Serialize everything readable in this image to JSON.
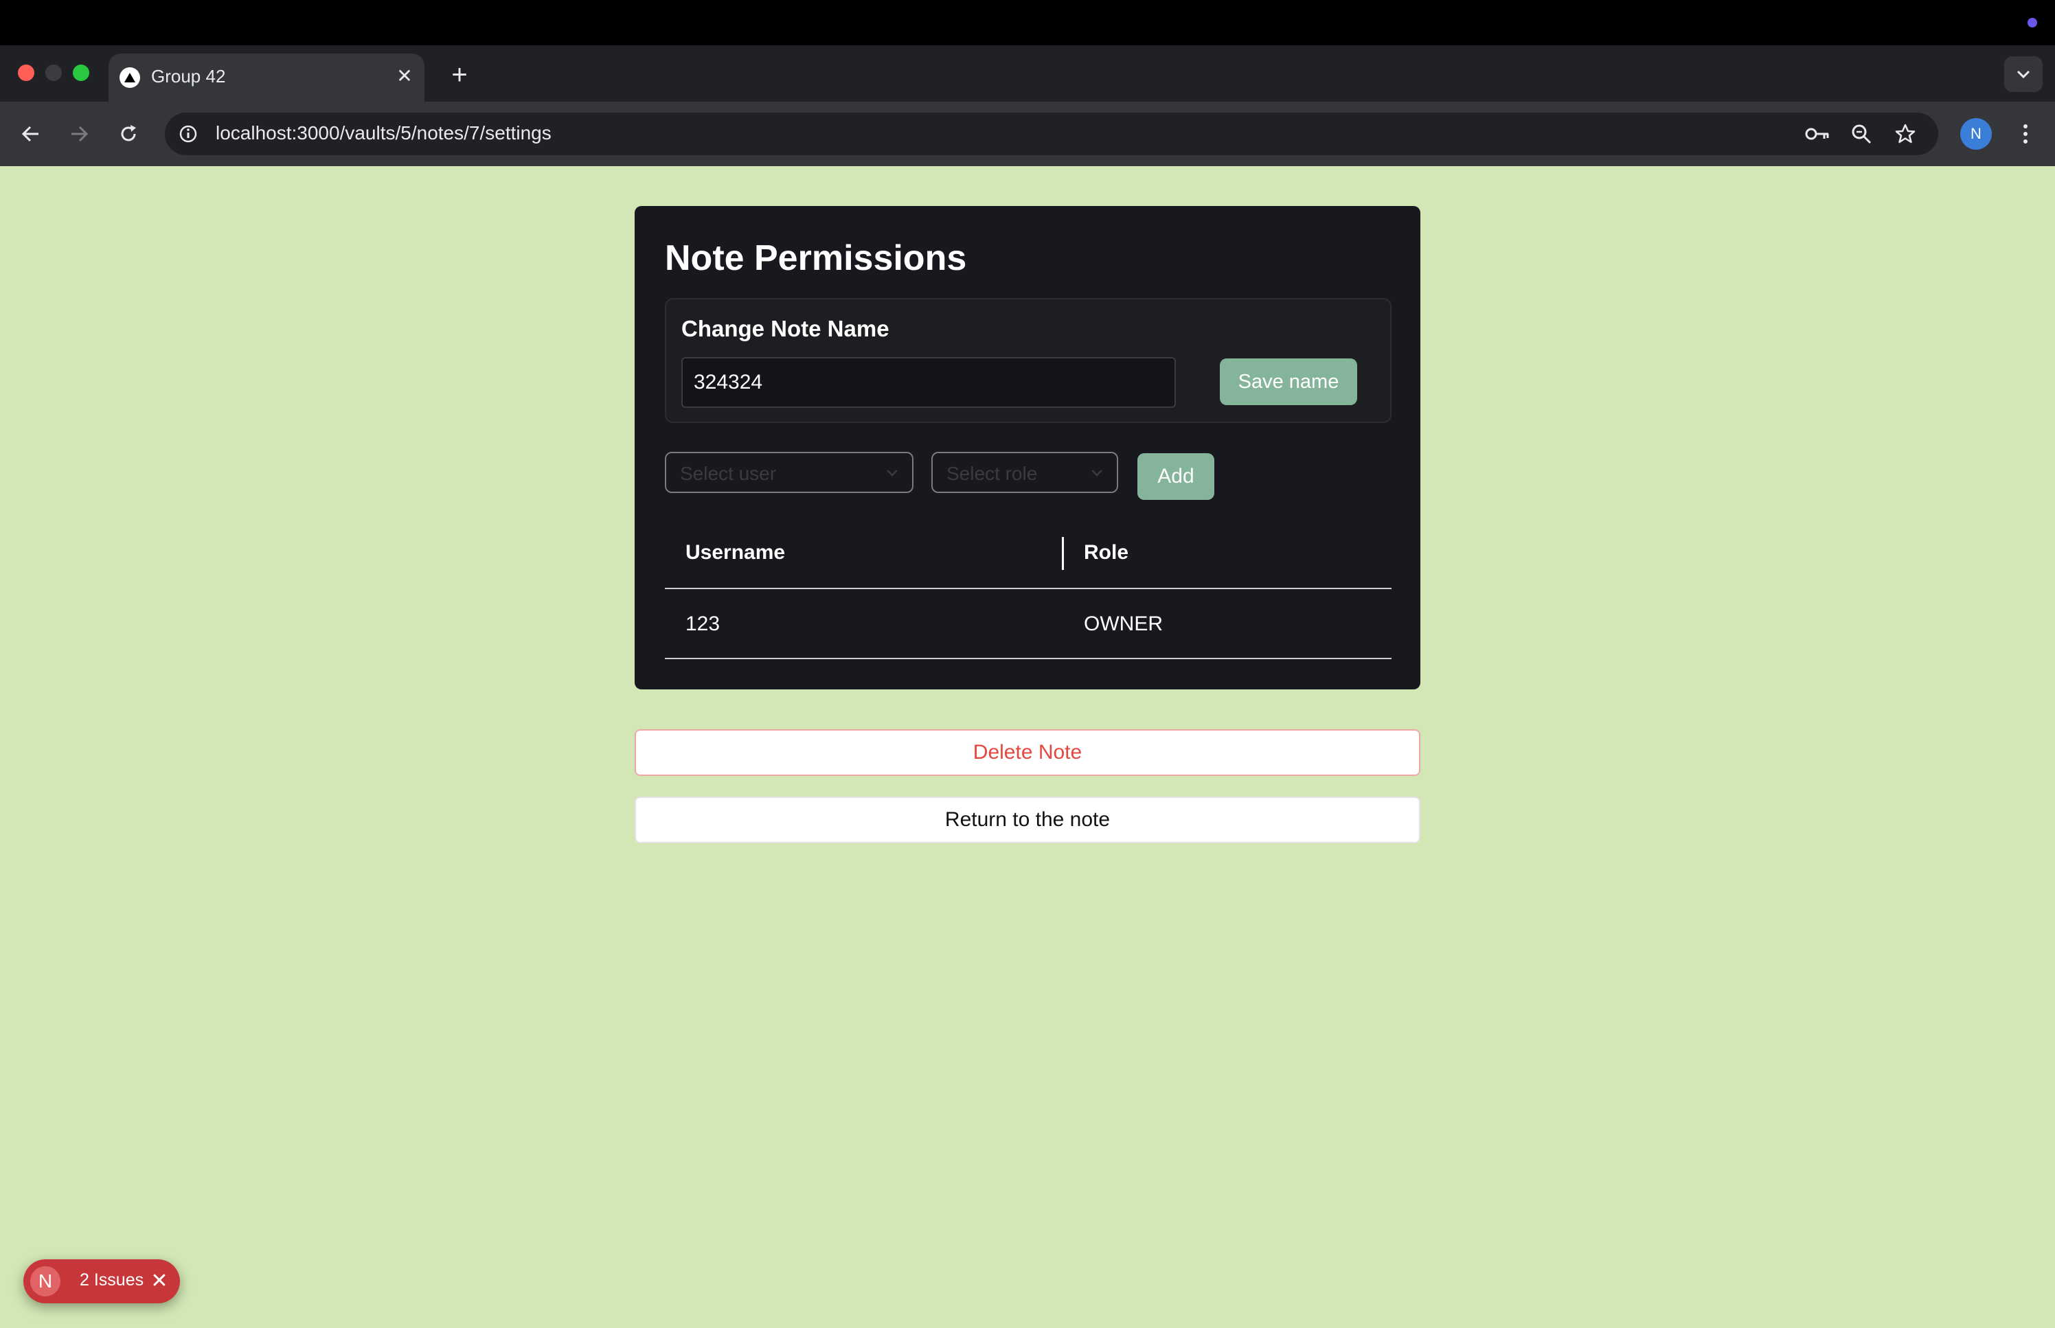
{
  "browser": {
    "tab_title": "Group 42",
    "tab_close": "✕",
    "new_tab": "+",
    "url": "localhost:3000/vaults/5/notes/7/settings",
    "profile_initial": "N"
  },
  "card": {
    "title": "Note Permissions",
    "name_section_label": "Change Note Name",
    "name_value": "324324",
    "save_label": "Save name",
    "user_select_placeholder": "Select user",
    "role_select_placeholder": "Select role",
    "add_label": "Add",
    "table": {
      "headers": [
        "Username",
        "Role"
      ],
      "rows": [
        [
          "123",
          "OWNER"
        ]
      ]
    }
  },
  "actions": {
    "delete_label": "Delete Note",
    "return_label": "Return to the note"
  },
  "issues_badge": {
    "logo": "N",
    "text": "2 Issues",
    "close": "✕"
  },
  "colors": {
    "page_bg": "#d2e7b5",
    "card_bg": "#18191e",
    "accent_button": "#84b59a",
    "danger": "#e5483f",
    "issues_badge": "#c7373a"
  }
}
